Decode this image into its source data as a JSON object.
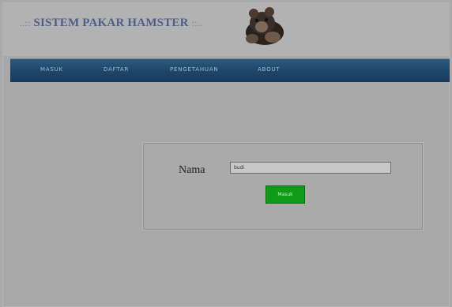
{
  "header": {
    "title": "SISTEM PAKAR HAMSTER",
    "deco_left": "..::",
    "deco_right": "::.."
  },
  "nav": {
    "items": [
      {
        "label": "MASUK"
      },
      {
        "label": "DAFTAR"
      },
      {
        "label": "PENGETAHUAN"
      },
      {
        "label": "ABOUT"
      }
    ]
  },
  "form": {
    "name_label": "Nama",
    "name_value": "budi",
    "submit_label": "Masuk"
  },
  "colors": {
    "nav_bar": "#20486b",
    "title": "#4c5f8c",
    "submit_button": "#0f9a18"
  },
  "icons": {
    "logo": "hamster-logo"
  }
}
